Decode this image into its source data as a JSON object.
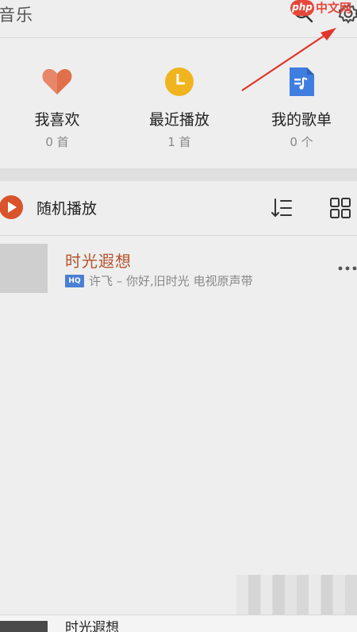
{
  "header": {
    "title": "音乐",
    "watermark_badge": "php",
    "watermark_site": "中文网"
  },
  "features": [
    {
      "label": "我喜欢",
      "count": "0 首",
      "icon": "heart-icon",
      "color": "#e0704a"
    },
    {
      "label": "最近播放",
      "count": "1 首",
      "icon": "clock-icon",
      "color": "#f0b51e"
    },
    {
      "label": "我的歌单",
      "count": "0 个",
      "icon": "playlist-icon",
      "color": "#3f7de0"
    }
  ],
  "controls": {
    "shuffle_label": "随机播放",
    "play_color": "#d9542b"
  },
  "songs": [
    {
      "title": "时光遐想",
      "badge": "HQ",
      "subtitle": "许飞 – 你好,旧时光 电视原声带"
    }
  ],
  "now_playing": {
    "title": "时光遐想"
  },
  "colors": {
    "accent": "#b4532c",
    "annotation": "#e0352b"
  }
}
